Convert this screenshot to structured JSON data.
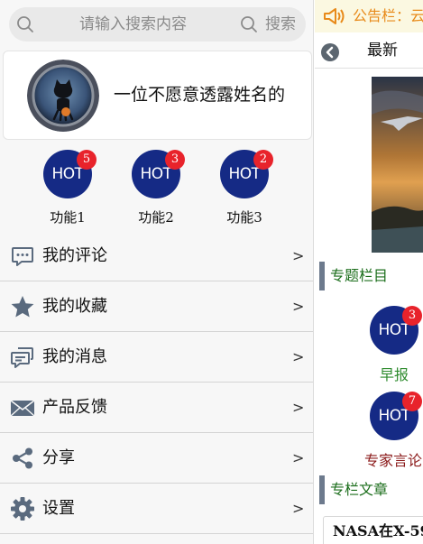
{
  "drawer": {
    "search": {
      "placeholder": "请输入搜索内容",
      "button_label": "搜索",
      "left_icon": "search-icon",
      "right_icon": "search-icon"
    },
    "profile": {
      "avatar_icon": "github-octocat-avatar",
      "username": "一位不愿意透露姓名的"
    },
    "features": [
      {
        "badge_text": "HOT",
        "count": "5",
        "label": "功能1"
      },
      {
        "badge_text": "HOT",
        "count": "3",
        "label": "功能2"
      },
      {
        "badge_text": "HOT",
        "count": "2",
        "label": "功能3"
      }
    ],
    "menu": [
      {
        "icon": "comment-icon",
        "label": "我的评论",
        "arrow": ">"
      },
      {
        "icon": "star-icon",
        "label": "我的收藏",
        "arrow": ">"
      },
      {
        "icon": "message-icon",
        "label": "我的消息",
        "arrow": ">"
      },
      {
        "icon": "mail-icon",
        "label": "产品反馈",
        "arrow": ">"
      },
      {
        "icon": "share-icon",
        "label": "分享",
        "arrow": ">"
      },
      {
        "icon": "gear-icon",
        "label": "设置",
        "arrow": ">"
      }
    ]
  },
  "page": {
    "notice": {
      "icon": "speaker-icon",
      "text": "公告栏：云"
    },
    "topbar": {
      "back_icon": "chevron-left-icon",
      "title": "最新"
    },
    "sections": {
      "topics": "专题栏目",
      "articles": "专栏文章"
    },
    "columns": [
      {
        "badge_text": "HOT",
        "count": "3",
        "label": "早报"
      },
      {
        "badge_text": "HOT",
        "count": "7",
        "label": "专家言论"
      }
    ],
    "article_title": "NASA在X-59"
  },
  "colors": {
    "hot_circle": "#152a85",
    "badge_red": "#e8232b",
    "notice_orange": "#e88a1a",
    "notice_bg": "#fbf8e1",
    "section_green": "#1c6e1c",
    "section_bar": "#6d7a8d",
    "icon_gray": "#5a6a7e",
    "column_label_green": "#2e8b2e",
    "column_label_red": "#8b1a1a"
  }
}
